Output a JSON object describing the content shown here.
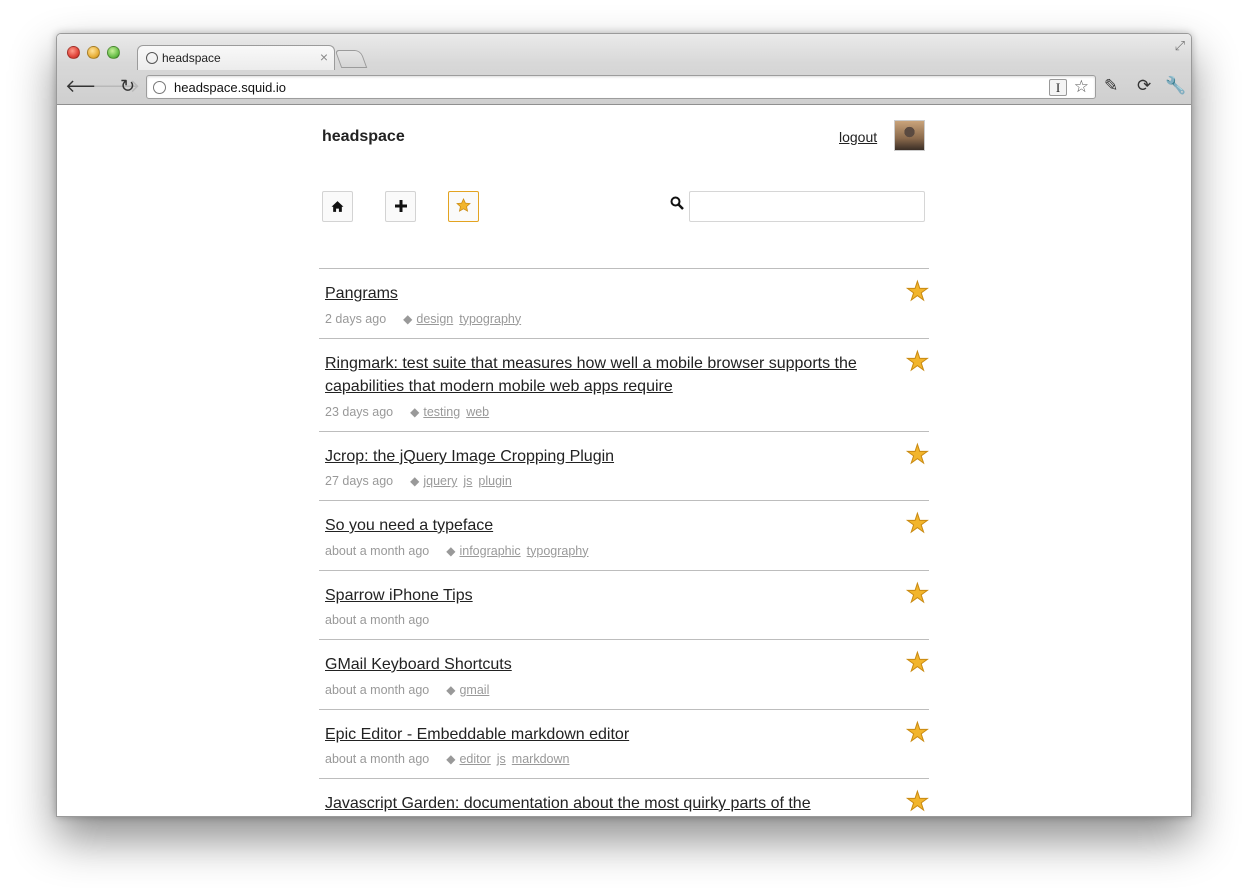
{
  "browser": {
    "tab_title": "headspace",
    "tab_close": "×",
    "url": "headspace.squid.io",
    "reader_icon_label": "I"
  },
  "header": {
    "brand": "headspace",
    "logout_label": "logout"
  },
  "actions": {
    "home_icon": "home-icon",
    "add_icon": "plus-icon",
    "starred_icon": "star-icon"
  },
  "search": {
    "value": "",
    "placeholder": ""
  },
  "colors": {
    "star": "#f2b52c",
    "active_border": "#e3a321",
    "link": "#222222",
    "meta": "#999999"
  },
  "bookmarks": [
    {
      "title": "Pangrams",
      "age": "2 days ago",
      "tags": [
        "design",
        "typography"
      ],
      "starred": true
    },
    {
      "title": "Ringmark: test suite that measures how well a mobile browser supports the capabilities that modern mobile web apps require",
      "age": "23 days ago",
      "tags": [
        "testing",
        "web"
      ],
      "starred": true
    },
    {
      "title": "Jcrop: the jQuery Image Cropping Plugin",
      "age": "27 days ago",
      "tags": [
        "jquery",
        "js",
        "plugin"
      ],
      "starred": true
    },
    {
      "title": "So you need a typeface",
      "age": "about a month ago",
      "tags": [
        "infographic",
        "typography"
      ],
      "starred": true
    },
    {
      "title": "Sparrow iPhone Tips",
      "age": "about a month ago",
      "tags": [],
      "starred": true
    },
    {
      "title": "GMail Keyboard Shortcuts",
      "age": "about a month ago",
      "tags": [
        "gmail"
      ],
      "starred": true
    },
    {
      "title": "Epic Editor - Embeddable markdown editor",
      "age": "about a month ago",
      "tags": [
        "editor",
        "js",
        "markdown"
      ],
      "starred": true
    },
    {
      "title": "Javascript Garden: documentation about the most quirky parts of the JavaScript",
      "age": "",
      "tags": [],
      "starred": true
    }
  ]
}
